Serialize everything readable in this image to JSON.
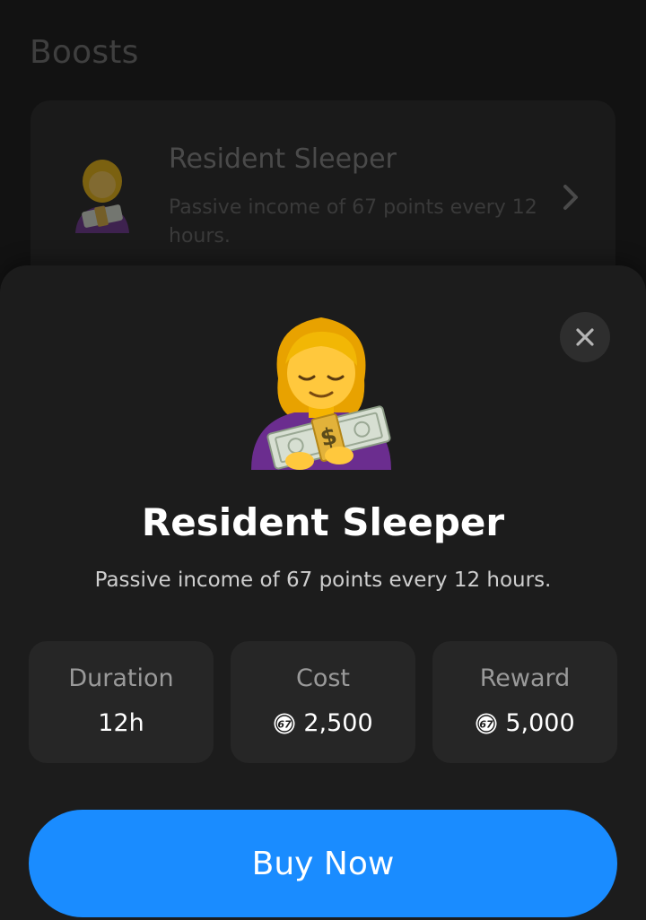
{
  "page": {
    "title": "Boosts"
  },
  "boost_card": {
    "title": "Resident Sleeper",
    "description": "Passive income of 67 points every 12 hours."
  },
  "sheet": {
    "title": "Resident Sleeper",
    "description": "Passive income of 67 points every 12 hours.",
    "stats": [
      {
        "label": "Duration",
        "value": "12h"
      },
      {
        "label": "Cost",
        "value": "2,500",
        "icon": "coin-67-icon"
      },
      {
        "label": "Reward",
        "value": "5,000",
        "icon": "coin-67-icon"
      }
    ],
    "buy_label": "Buy Now"
  },
  "coin_text": "67",
  "colors": {
    "accent": "#1a8cff",
    "sheet_bg": "#1c1c1c",
    "stat_bg": "#262626"
  }
}
